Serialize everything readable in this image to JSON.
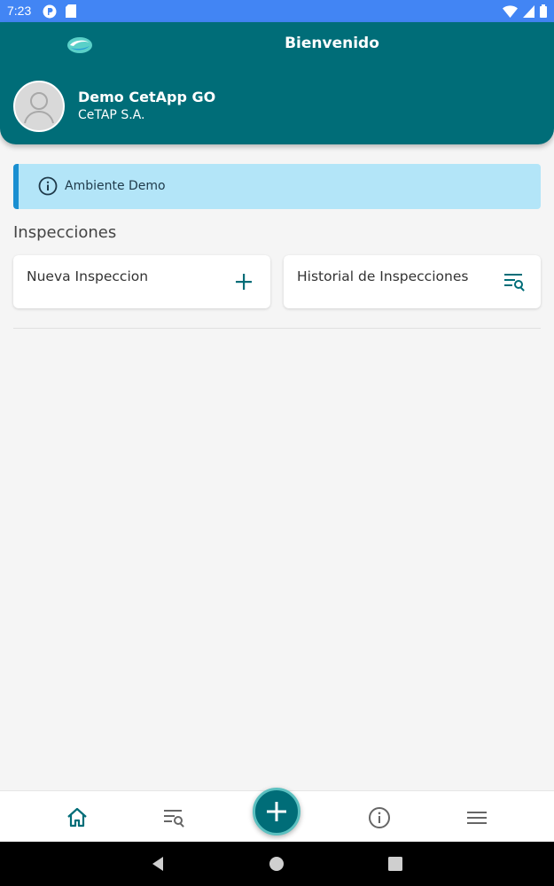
{
  "status_bar": {
    "time": "7:23",
    "left_icons": [
      "notification-p-icon",
      "sd-card-icon"
    ],
    "right_icons": [
      "wifi-icon",
      "signal-icon",
      "battery-icon"
    ]
  },
  "header": {
    "title": "Bienvenido",
    "logo": "app-logo-icon",
    "user": {
      "name": "Demo CetApp GO",
      "company": "CeTAP S.A."
    }
  },
  "alert": {
    "icon": "info-icon",
    "text": "Ambiente Demo"
  },
  "inspections": {
    "section_title": "Inspecciones",
    "cards": [
      {
        "label": "Nueva Inspeccion",
        "icon": "plus-icon"
      },
      {
        "label": "Historial de Inspecciones",
        "icon": "list-search-icon"
      }
    ]
  },
  "bottom_nav": {
    "items": [
      "home-icon",
      "list-search-icon",
      "add-icon",
      "info-icon",
      "menu-icon"
    ],
    "active": "home-icon"
  },
  "system_nav": [
    "back-icon",
    "home-circle-icon",
    "recents-icon"
  ],
  "colors": {
    "primary": "#006d78",
    "status_bar": "#4285f4",
    "alert_bg": "#b3e5f8",
    "alert_border": "#1a8fd1",
    "background": "#f5f5f5"
  }
}
